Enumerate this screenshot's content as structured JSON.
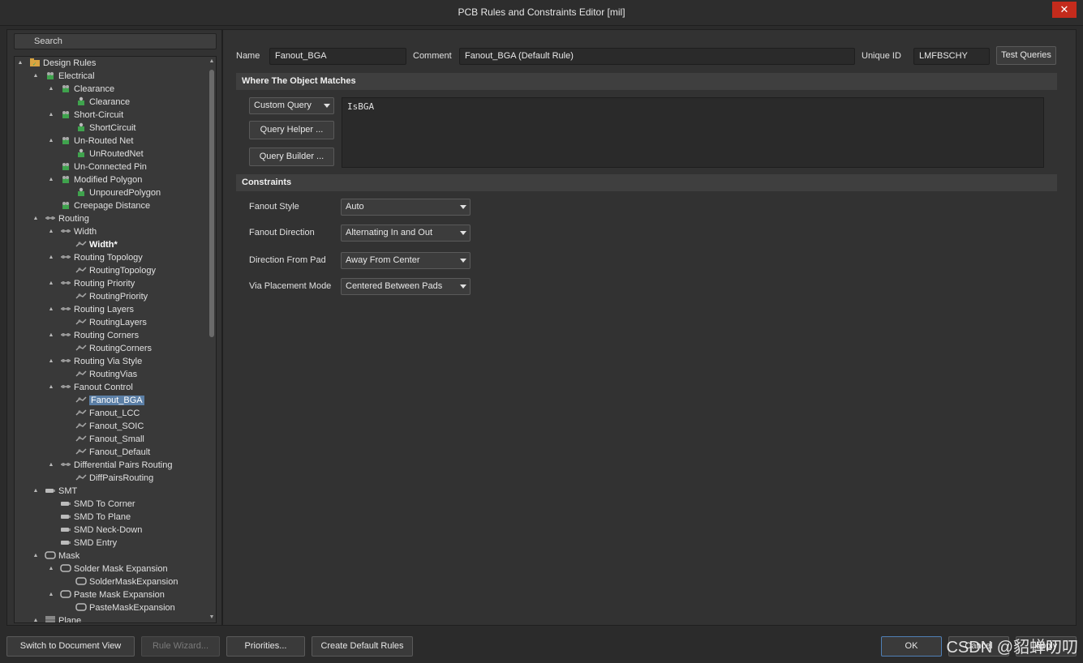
{
  "window": {
    "title": "PCB Rules and Constraints Editor [mil]",
    "close_glyph": "✕"
  },
  "search": {
    "placeholder": "Search"
  },
  "tree": [
    {
      "label": "Design Rules",
      "icon": "rules-folder-icon",
      "toggle": "▲",
      "bold": false,
      "selected": false
    },
    {
      "label": "Electrical",
      "icon": "electrical-icon",
      "toggle": "▲"
    },
    {
      "label": "Clearance",
      "icon": "electrical-icon",
      "toggle": "▲"
    },
    {
      "label": "Clearance",
      "icon": "electrical-rule-icon"
    },
    {
      "label": "Short-Circuit",
      "icon": "electrical-icon",
      "toggle": "▲"
    },
    {
      "label": "ShortCircuit",
      "icon": "electrical-rule-icon"
    },
    {
      "label": "Un-Routed Net",
      "icon": "electrical-icon",
      "toggle": "▲"
    },
    {
      "label": "UnRoutedNet",
      "icon": "electrical-rule-icon"
    },
    {
      "label": "Un-Connected Pin",
      "icon": "electrical-icon"
    },
    {
      "label": "Modified Polygon",
      "icon": "electrical-icon",
      "toggle": "▲"
    },
    {
      "label": "UnpouredPolygon",
      "icon": "electrical-rule-icon"
    },
    {
      "label": "Creepage Distance",
      "icon": "electrical-icon"
    },
    {
      "label": "Routing",
      "icon": "routing-icon",
      "toggle": "▲"
    },
    {
      "label": "Width",
      "icon": "routing-icon",
      "toggle": "▲"
    },
    {
      "label": "Width*",
      "icon": "routing-rule-icon",
      "bold": true
    },
    {
      "label": "Routing Topology",
      "icon": "routing-icon",
      "toggle": "▲"
    },
    {
      "label": "RoutingTopology",
      "icon": "routing-rule-icon"
    },
    {
      "label": "Routing Priority",
      "icon": "routing-icon",
      "toggle": "▲"
    },
    {
      "label": "RoutingPriority",
      "icon": "routing-rule-icon"
    },
    {
      "label": "Routing Layers",
      "icon": "routing-icon",
      "toggle": "▲"
    },
    {
      "label": "RoutingLayers",
      "icon": "routing-rule-icon"
    },
    {
      "label": "Routing Corners",
      "icon": "routing-icon",
      "toggle": "▲"
    },
    {
      "label": "RoutingCorners",
      "icon": "routing-rule-icon"
    },
    {
      "label": "Routing Via Style",
      "icon": "routing-icon",
      "toggle": "▲"
    },
    {
      "label": "RoutingVias",
      "icon": "routing-rule-icon"
    },
    {
      "label": "Fanout Control",
      "icon": "routing-icon",
      "toggle": "▲"
    },
    {
      "label": "Fanout_BGA",
      "icon": "routing-rule-icon",
      "selected": true
    },
    {
      "label": "Fanout_LCC",
      "icon": "routing-rule-icon"
    },
    {
      "label": "Fanout_SOIC",
      "icon": "routing-rule-icon"
    },
    {
      "label": "Fanout_Small",
      "icon": "routing-rule-icon"
    },
    {
      "label": "Fanout_Default",
      "icon": "routing-rule-icon"
    },
    {
      "label": "Differential Pairs Routing",
      "icon": "routing-icon",
      "toggle": "▲"
    },
    {
      "label": "DiffPairsRouting",
      "icon": "routing-rule-icon"
    },
    {
      "label": "SMT",
      "icon": "smt-icon",
      "toggle": "▲"
    },
    {
      "label": "SMD To Corner",
      "icon": "smt-icon"
    },
    {
      "label": "SMD To Plane",
      "icon": "smt-icon"
    },
    {
      "label": "SMD Neck-Down",
      "icon": "smt-icon"
    },
    {
      "label": "SMD Entry",
      "icon": "smt-icon"
    },
    {
      "label": "Mask",
      "icon": "mask-icon",
      "toggle": "▲"
    },
    {
      "label": "Solder Mask Expansion",
      "icon": "mask-icon",
      "toggle": "▲"
    },
    {
      "label": "SolderMaskExpansion",
      "icon": "mask-icon"
    },
    {
      "label": "Paste Mask Expansion",
      "icon": "mask-icon",
      "toggle": "▲"
    },
    {
      "label": "PasteMaskExpansion",
      "icon": "mask-icon"
    },
    {
      "label": "Plane",
      "icon": "plane-icon",
      "toggle": "▲"
    }
  ],
  "rule": {
    "name_label": "Name",
    "name_value": "Fanout_BGA",
    "comment_label": "Comment",
    "comment_value": "Fanout_BGA (Default Rule)",
    "uid_label": "Unique ID",
    "uid_value": "LMFBSCHY",
    "test_queries": "Test Queries"
  },
  "where": {
    "header": "Where The Object Matches",
    "query_type": "Custom Query",
    "query_helper": "Query Helper ...",
    "query_builder": "Query Builder ...",
    "query_text": "IsBGA"
  },
  "constraints": {
    "header": "Constraints",
    "fields": [
      {
        "label": "Fanout Style",
        "value": "Auto"
      },
      {
        "label": "Fanout Direction",
        "value": "Alternating In and Out"
      },
      {
        "label": "Direction From Pad",
        "value": "Away From Center"
      },
      {
        "label": "Via Placement Mode",
        "value": "Centered Between Pads"
      }
    ]
  },
  "bottom": {
    "switch_view": "Switch to Document View",
    "rule_wizard": "Rule Wizard...",
    "priorities": "Priorities...",
    "create_defaults": "Create Default Rules",
    "ok": "OK",
    "cancel": "Cancel",
    "apply": "Apply"
  },
  "watermark": "CSDN @貂蝉叨叨",
  "colors": {
    "accent": "#5b7fa6",
    "close": "#c42b1c",
    "electrical": "#3fa34d",
    "background": "#2b2b2b"
  }
}
